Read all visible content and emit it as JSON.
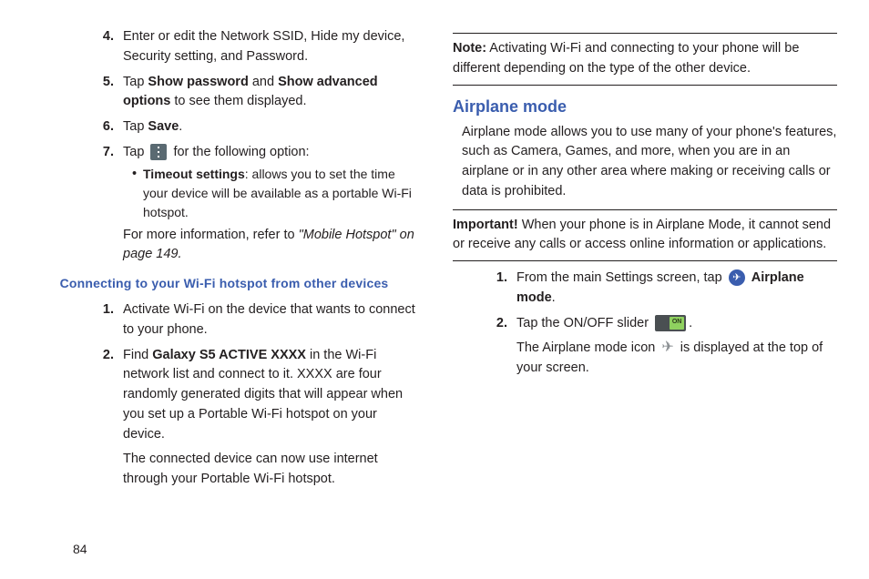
{
  "pageNumber": "84",
  "left": {
    "items": [
      {
        "num": "4.",
        "text": "Enter or edit the Network SSID, Hide my device, Security setting, and Password."
      },
      {
        "num": "5.",
        "preText": "Tap ",
        "b1": "Show password",
        "mid": " and ",
        "b2": "Show advanced options",
        "postText": " to see them displayed."
      },
      {
        "num": "6.",
        "preText": "Tap ",
        "b1": "Save",
        "postText": "."
      },
      {
        "num": "7.",
        "preText": "Tap ",
        "postText": " for the following option:"
      }
    ],
    "bulletLabel": "Timeout settings",
    "bulletText": ": allows you to set the time your device will be available as a portable Wi-Fi hotspot.",
    "moreInfoPre": "For more information, refer to ",
    "moreInfoItalic": "\"Mobile Hotspot\"  on page 149.",
    "subhead": "Connecting to your Wi-Fi hotspot from other devices",
    "items2": [
      {
        "num": "1.",
        "text": "Activate Wi-Fi on the device that wants to connect to your phone."
      },
      {
        "num": "2.",
        "preText": "Find ",
        "b1": "Galaxy S5 ACTIVE XXXX",
        "postText": " in the Wi-Fi network list and connect to it. XXXX are four randomly generated digits that will appear when you set up a Portable Wi-Fi hotspot on your device."
      }
    ],
    "connectedText": "The connected device can now use internet through your Portable Wi-Fi hotspot."
  },
  "right": {
    "noteLabel": "Note:",
    "noteText": " Activating Wi-Fi and connecting to your phone will be different depending on the type of the other device.",
    "sectionHead": "Airplane mode",
    "sectionPara": "Airplane mode allows you to use many of your phone's features, such as Camera, Games, and more, when you are in an airplane or in any other area where making or receiving calls or data is prohibited.",
    "impLabel": "Important!",
    "impText": " When your phone is in Airplane Mode, it cannot send or receive any calls or access online information or applications.",
    "items": [
      {
        "num": "1.",
        "preText": "From the main Settings screen, tap ",
        "b1": "Airplane mode",
        "postText": "."
      },
      {
        "num": "2.",
        "preText": "Tap the ON/OFF slider ",
        "postText": "."
      }
    ],
    "afterText1": "The Airplane mode icon ",
    "afterText2": " is displayed at the top of your screen."
  }
}
